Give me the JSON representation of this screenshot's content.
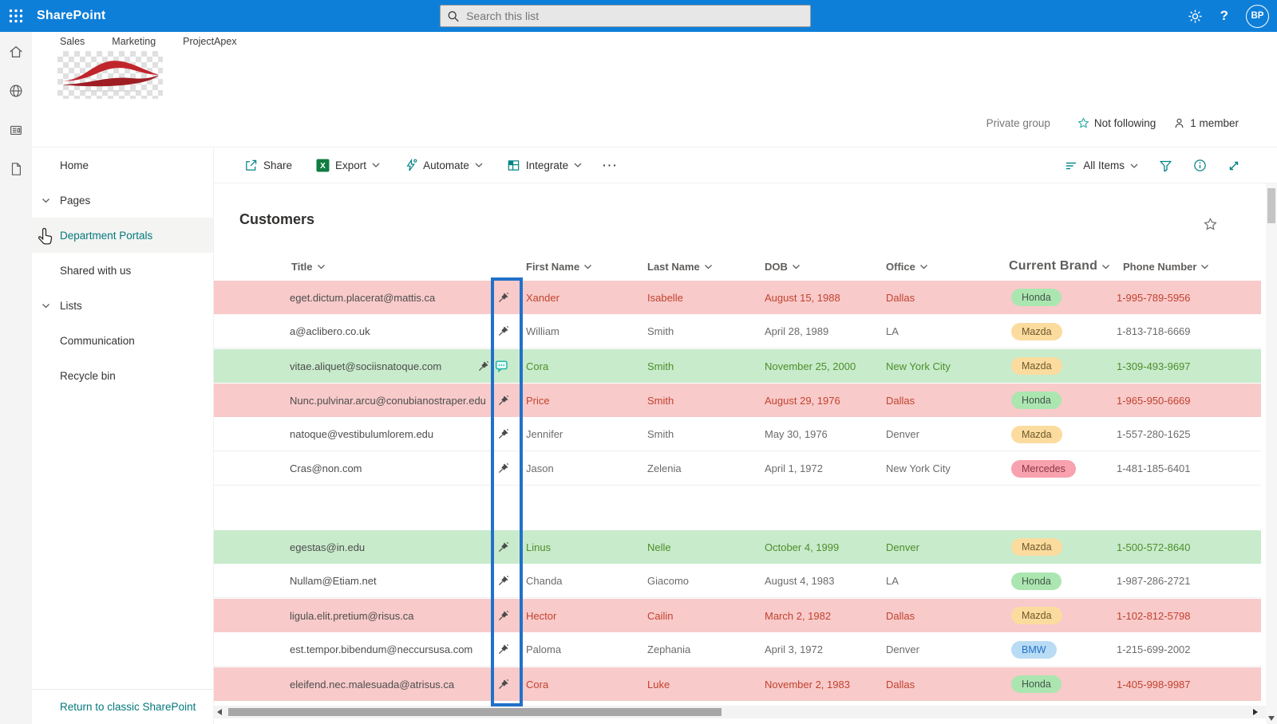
{
  "topbar": {
    "app_name": "SharePoint",
    "search_placeholder": "Search this list",
    "avatar_initials": "BP"
  },
  "site_header": {
    "tabs": [
      "Sales",
      "Marketing",
      "ProjectApex"
    ],
    "privacy": "Private group",
    "following": "Not following",
    "members": "1 member"
  },
  "sidebar": {
    "items": [
      {
        "label": "Home",
        "expandable": false,
        "active": false
      },
      {
        "label": "Pages",
        "expandable": true,
        "active": false
      },
      {
        "label": "Department Portals",
        "expandable": false,
        "active": true
      },
      {
        "label": "Shared with us",
        "expandable": false,
        "active": false
      },
      {
        "label": "Lists",
        "expandable": true,
        "active": false
      },
      {
        "label": "Communication",
        "expandable": false,
        "active": false
      },
      {
        "label": "Recycle bin",
        "expandable": false,
        "active": false
      }
    ],
    "footer_link": "Return to classic SharePoint"
  },
  "command_bar": {
    "share": "Share",
    "export": "Export",
    "automate": "Automate",
    "integrate": "Integrate",
    "overflow": "···",
    "view": "All Items"
  },
  "list": {
    "title": "Customers",
    "columns": [
      "Title",
      "First Name",
      "Last Name",
      "DOB",
      "Office",
      "Current Brand",
      "Phone Number"
    ],
    "rows": [
      {
        "tone": "pink",
        "title": "eget.dictum.placerat@mattis.ca",
        "first": "Xander",
        "last": "Isabelle",
        "dob": "August 15, 1988",
        "office": "Dallas",
        "brand": "Honda",
        "phone": "1-995-789-5956",
        "has_note": false,
        "gap_before": false
      },
      {
        "tone": "white",
        "title": "a@aclibero.co.uk",
        "first": "William",
        "last": "Smith",
        "dob": "April 28, 1989",
        "office": "LA",
        "brand": "Mazda",
        "phone": "1-813-718-6669",
        "has_note": false,
        "gap_before": false
      },
      {
        "tone": "green",
        "title": "vitae.aliquet@sociisnatoque.com",
        "first": "Cora",
        "last": "Smith",
        "dob": "November 25, 2000",
        "office": "New York City",
        "brand": "Mazda",
        "phone": "1-309-493-9697",
        "has_note": true,
        "gap_before": false
      },
      {
        "tone": "pink",
        "title": "Nunc.pulvinar.arcu@conubianostraper.edu",
        "first": "Price",
        "last": "Smith",
        "dob": "August 29, 1976",
        "office": "Dallas",
        "brand": "Honda",
        "phone": "1-965-950-6669",
        "has_note": false,
        "gap_before": false
      },
      {
        "tone": "white",
        "title": "natoque@vestibulumlorem.edu",
        "first": "Jennifer",
        "last": "Smith",
        "dob": "May 30, 1976",
        "office": "Denver",
        "brand": "Mazda",
        "phone": "1-557-280-1625",
        "has_note": false,
        "gap_before": false
      },
      {
        "tone": "white",
        "title": "Cras@non.com",
        "first": "Jason",
        "last": "Zelenia",
        "dob": "April 1, 1972",
        "office": "New York City",
        "brand": "Mercedes",
        "phone": "1-481-185-6401",
        "has_note": false,
        "gap_before": false
      },
      {
        "tone": "green",
        "title": "egestas@in.edu",
        "first": "Linus",
        "last": "Nelle",
        "dob": "October 4, 1999",
        "office": "Denver",
        "brand": "Mazda",
        "phone": "1-500-572-8640",
        "has_note": false,
        "gap_before": true
      },
      {
        "tone": "white",
        "title": "Nullam@Etiam.net",
        "first": "Chanda",
        "last": "Giacomo",
        "dob": "August 4, 1983",
        "office": "LA",
        "brand": "Honda",
        "phone": "1-987-286-2721",
        "has_note": false,
        "gap_before": false
      },
      {
        "tone": "pink",
        "title": "ligula.elit.pretium@risus.ca",
        "first": "Hector",
        "last": "Cailin",
        "dob": "March 2, 1982",
        "office": "Dallas",
        "brand": "Mazda",
        "phone": "1-102-812-5798",
        "has_note": false,
        "gap_before": false
      },
      {
        "tone": "white",
        "title": "est.tempor.bibendum@neccursusa.com",
        "first": "Paloma",
        "last": "Zephania",
        "dob": "April 3, 1972",
        "office": "Denver",
        "brand": "BMW",
        "phone": "1-215-699-2002",
        "has_note": false,
        "gap_before": false
      },
      {
        "tone": "pink",
        "title": "eleifend.nec.malesuada@atrisus.ca",
        "first": "Cora",
        "last": "Luke",
        "dob": "November 2, 1983",
        "office": "Dallas",
        "brand": "Honda",
        "phone": "1-405-998-9987",
        "has_note": false,
        "gap_before": false
      }
    ]
  },
  "colors": {
    "topbar_blue": "#0e7fd9",
    "accent_teal": "#038387",
    "highlight_blue": "#2271c9",
    "row_pink": "#f8caca",
    "row_green": "#c8ebcb",
    "text_red": "#c1432f",
    "text_green": "#4e8e2c",
    "badges": {
      "Honda": {
        "bg": "#abe6b0",
        "text": "#45564a"
      },
      "Mazda": {
        "bg": "#fbdc9e",
        "text": "#6d572a"
      },
      "Mercedes": {
        "bg": "#f7a2ae",
        "text": "#8e3744"
      },
      "BMW": {
        "bg": "#b9dcf4",
        "text": "#2173c9"
      }
    }
  }
}
